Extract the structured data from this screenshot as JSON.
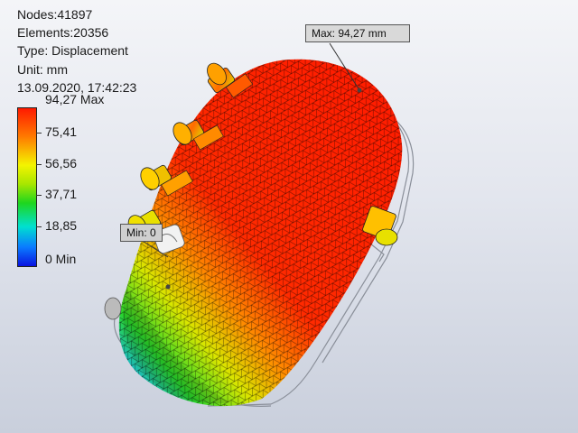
{
  "info": {
    "nodes": "Nodes:41897",
    "elements": "Elements:20356",
    "type": "Type: Displacement",
    "unit": "Unit: mm",
    "timestamp": "13.09.2020, 17:42:23"
  },
  "legend": {
    "max_label": "94,27 Max",
    "ticks": [
      "75,41",
      "56,56",
      "37,71",
      "18,85"
    ],
    "min_label": "0 Min",
    "colors": [
      "#ff1a00",
      "#ff7a00",
      "#f4f400",
      "#1ed61e",
      "#00e0d0",
      "#0a7bff",
      "#0a14e0"
    ]
  },
  "callouts": {
    "max": "Max: 94,27 mm",
    "min": "Min: 0"
  }
}
